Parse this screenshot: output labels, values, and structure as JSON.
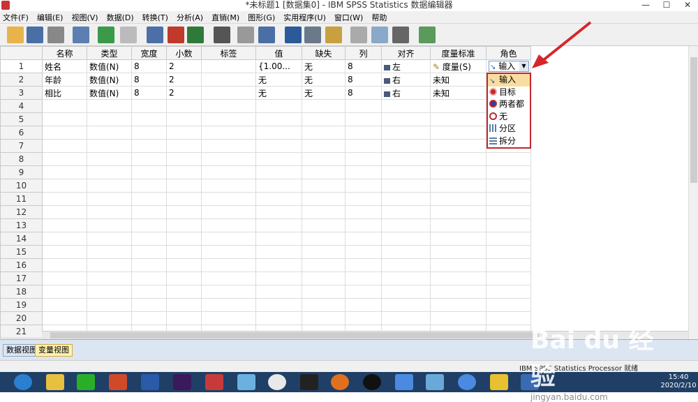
{
  "window": {
    "title": "*未标题1 [数据集0] - IBM SPSS Statistics 数据编辑器",
    "min": "—",
    "max": "☐",
    "close": "✕"
  },
  "menu": [
    "文件(F)",
    "编辑(E)",
    "视图(V)",
    "数据(D)",
    "转换(T)",
    "分析(A)",
    "直销(M)",
    "图形(G)",
    "实用程序(U)",
    "窗口(W)",
    "帮助"
  ],
  "columns": [
    "名称",
    "类型",
    "宽度",
    "小数",
    "标签",
    "值",
    "缺失",
    "列",
    "对齐",
    "度量标准",
    "角色"
  ],
  "rows": [
    {
      "n": "1",
      "name": "姓名",
      "type": "数值(N)",
      "width": "8",
      "dec": "2",
      "label": "",
      "values": "{1.00...",
      "missing": "无",
      "cols": "8",
      "align": "左",
      "measure": "度量(S)",
      "role": "输入"
    },
    {
      "n": "2",
      "name": "年龄",
      "type": "数值(N)",
      "width": "8",
      "dec": "2",
      "label": "",
      "values": "无",
      "missing": "无",
      "cols": "8",
      "align": "右",
      "measure": "未知",
      "role": ""
    },
    {
      "n": "3",
      "name": "相比",
      "type": "数值(N)",
      "width": "8",
      "dec": "2",
      "label": "",
      "values": "无",
      "missing": "无",
      "cols": "8",
      "align": "右",
      "measure": "未知",
      "role": ""
    }
  ],
  "empty_rows": [
    "4",
    "5",
    "6",
    "7",
    "8",
    "9",
    "10",
    "11",
    "12",
    "13",
    "14",
    "15",
    "16",
    "17",
    "18",
    "19",
    "20",
    "21"
  ],
  "role_options": [
    "输入",
    "目标",
    "两者都",
    "无",
    "分区",
    "拆分"
  ],
  "tabs": {
    "data": "数据视图",
    "variable": "变量视图"
  },
  "status": "IBM SPSS Statistics Processor 就绪",
  "clock": {
    "time": "15:40",
    "date": "2020/2/10"
  },
  "watermark": {
    "main": "Bai du 经验",
    "sub": "jingyan.baidu.com"
  },
  "colors": {
    "arrow": "#d6262c",
    "highlight": "#f9dda0",
    "active_tab": "#fff2b0"
  }
}
